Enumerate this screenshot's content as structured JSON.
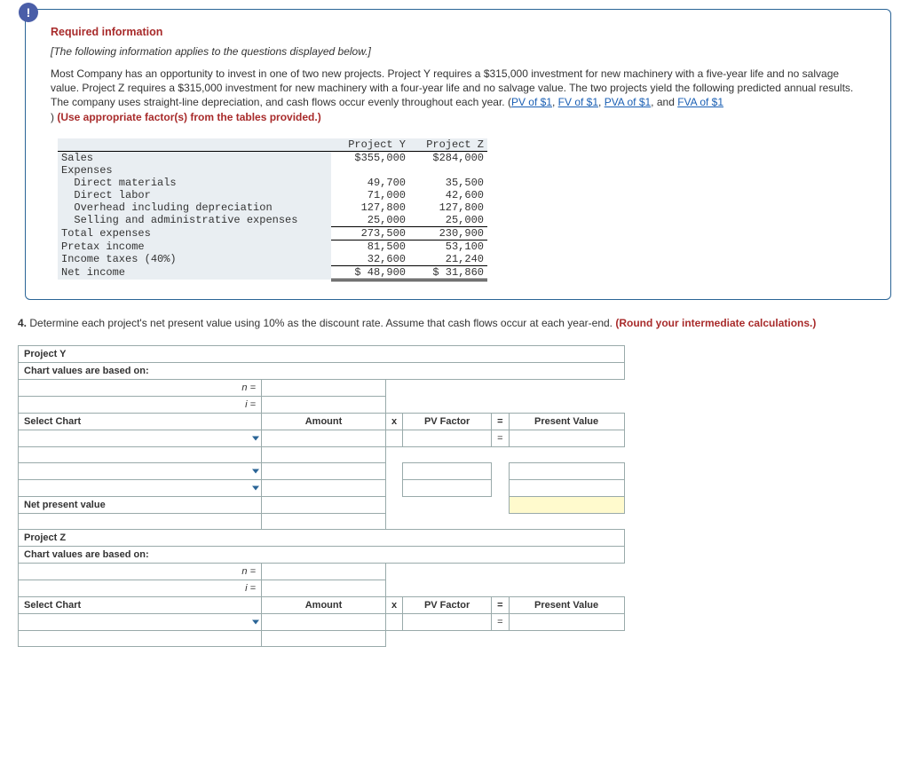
{
  "info": {
    "heading": "Required information",
    "subheading": "[The following information applies to the questions displayed below.]",
    "paragraph_prefix": "Most Company has an opportunity to invest in one of two new projects. Project Y requires a $315,000 investment for new machinery with a five-year life and no salvage value. Project Z requires a $315,000 investment for new machinery with a four-year life and no salvage value. The two projects yield the following predicted annual results. The company uses straight-line depreciation, and cash flows occur evenly throughout each year. (",
    "links": {
      "pv": "PV of $1",
      "fv": "FV of $1",
      "pva": "PVA of $1",
      "fva": "FVA of $1"
    },
    "paragraph_suffix_close": " )",
    "red_text": " (Use appropriate factor(s) from the tables provided.)",
    "comma": ", ",
    "and": ", and "
  },
  "income_table": {
    "headers": {
      "y": "Project Y",
      "z": "Project Z"
    },
    "rows": {
      "sales": {
        "label": "Sales",
        "y": "$355,000",
        "z": "$284,000"
      },
      "expenses": {
        "label": "Expenses"
      },
      "dm": {
        "label": "  Direct materials",
        "y": "49,700",
        "z": "35,500"
      },
      "dl": {
        "label": "  Direct labor",
        "y": "71,000",
        "z": "42,600"
      },
      "oh": {
        "label": "  Overhead including depreciation",
        "y": "127,800",
        "z": "127,800"
      },
      "sa": {
        "label": "  Selling and administrative expenses",
        "y": "25,000",
        "z": "25,000"
      },
      "te": {
        "label": "Total expenses",
        "y": "273,500",
        "z": "230,900"
      },
      "pi": {
        "label": "Pretax income",
        "y": "81,500",
        "z": "53,100"
      },
      "tax": {
        "label": "Income taxes (40%)",
        "y": "32,600",
        "z": "21,240"
      },
      "ni": {
        "label": "Net income",
        "y": "$ 48,900",
        "z": "$ 31,860"
      }
    }
  },
  "question": {
    "num": "4.",
    "text": " Determine each project's net present value using 10% as the discount rate. Assume that cash flows occur at each year-end. ",
    "red": "(Round your intermediate calculations.)"
  },
  "form": {
    "projects": {
      "y": "Project Y",
      "z": "Project Z"
    },
    "chart_basis": "Chart values are based on:",
    "n_label": "n =",
    "i_label": "i =",
    "select_chart": "Select Chart",
    "amount": "Amount",
    "x": "x",
    "pv_factor": "PV Factor",
    "eq": "=",
    "present_value": "Present Value",
    "npv": "Net present value"
  }
}
